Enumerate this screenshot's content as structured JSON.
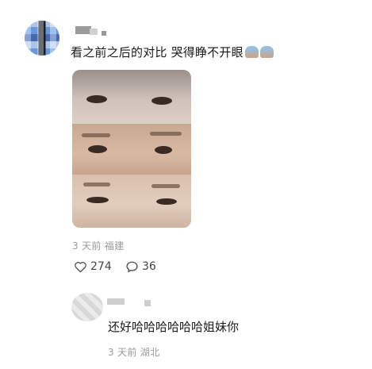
{
  "comment": {
    "text": "看之前之后的对比 哭得睁不开眼",
    "time": "3 天前",
    "location": "福建",
    "likes": "274",
    "replies": "36",
    "emoji_icons": [
      "crying-face-emoji",
      "crying-face-emoji"
    ]
  },
  "reply": {
    "text": "还好哈哈哈哈哈哈姐妹你",
    "time": "3 天前",
    "location": "湖北"
  },
  "icons": {
    "like": "heart-icon",
    "reply": "speech-bubble-icon"
  }
}
